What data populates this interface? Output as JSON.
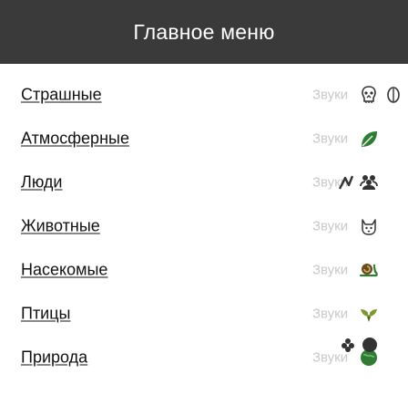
{
  "header": {
    "title": "Главное меню"
  },
  "menu": {
    "items": [
      {
        "label": "Страшные",
        "sounds_label": "Звуки"
      },
      {
        "label": "Атмосферные",
        "sounds_label": "Звуки"
      },
      {
        "label": "Люди",
        "sounds_label": "Звуки"
      },
      {
        "label": "Животные",
        "sounds_label": "Звуки"
      },
      {
        "label": "Насекомые",
        "sounds_label": "Звуки"
      },
      {
        "label": "Птицы",
        "sounds_label": "Звуки"
      },
      {
        "label": "Природа",
        "sounds_label": "Звуки"
      }
    ]
  },
  "colors": {
    "header_bg": "#3a3a3a",
    "header_text": "#ffffff",
    "link_text": "#111111",
    "sounds_text": "#c8c8c8",
    "icon_green": "#2e7d32",
    "icon_dark": "#333333"
  }
}
